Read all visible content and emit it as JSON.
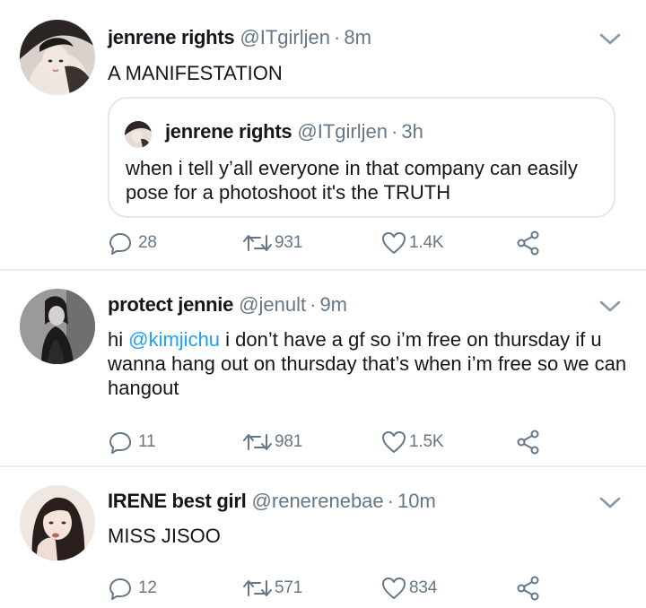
{
  "tweets": [
    {
      "name": "jenrene rights",
      "handle": "@ITgirljen",
      "separator": "·",
      "time": "8m",
      "text": "A MANIFESTATION",
      "quote": {
        "name": "jenrene rights",
        "handle": "@ITgirljen",
        "separator": "·",
        "time": "3h",
        "text": "when i tell y’all everyone in that company can easily pose for a photoshoot it's the TRUTH"
      },
      "replies": "28",
      "retweets": "931",
      "likes": "1.4K"
    },
    {
      "name": "protect jennie",
      "handle": "@jenult",
      "separator": "·",
      "time": "9m",
      "text_before_mention": "hi ",
      "mention": "@kimjichu",
      "text_after_mention": " i don’t have a gf so i’m free on thursday if u wanna hang out on thursday that’s when i’m free so we can hangout",
      "replies": "11",
      "retweets": "981",
      "likes": "1.5K"
    },
    {
      "name": "IRENE best girl",
      "handle": "@renerenebae",
      "separator": "·",
      "time": "10m",
      "text": "MISS JISOO",
      "replies": "12",
      "retweets": "571",
      "likes": "834"
    }
  ],
  "icons": {
    "reply": "reply-icon",
    "retweet": "retweet-icon",
    "like": "heart-icon",
    "share": "share-icon",
    "more": "chevron-down-icon"
  },
  "colors": {
    "text": "#14171a",
    "muted": "#657786",
    "link": "#1da1f2",
    "divider": "#e6ecf0"
  }
}
